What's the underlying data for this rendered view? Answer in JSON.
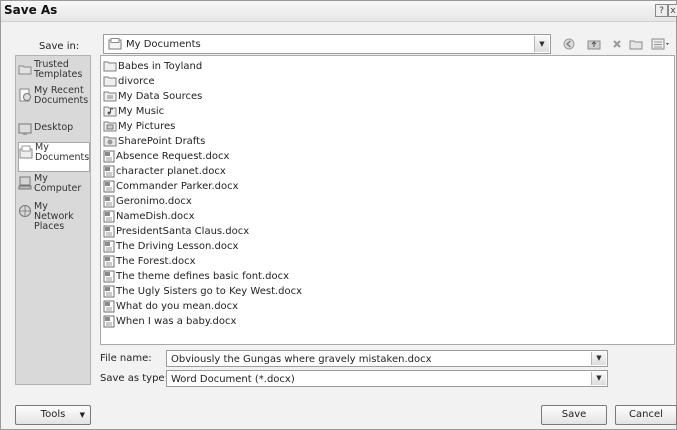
{
  "window": {
    "title": "Save As",
    "help_glyph": "?",
    "close_glyph": "x"
  },
  "save_in": {
    "label": "Save in:",
    "value": "My Documents",
    "toolbar": [
      "back-icon",
      "up-folder-icon",
      "delete-icon",
      "new-folder-icon",
      "views-icon"
    ]
  },
  "places": [
    {
      "label": "Trusted Templates",
      "icon": "trusted-templates-icon",
      "selected": false
    },
    {
      "label": "My Recent Documents",
      "icon": "recent-documents-icon",
      "selected": false
    },
    {
      "label": "Desktop",
      "icon": "desktop-icon",
      "selected": false
    },
    {
      "label": "My Documents",
      "icon": "my-documents-icon",
      "selected": true
    },
    {
      "label": "My Computer",
      "icon": "my-computer-icon",
      "selected": false
    },
    {
      "label": "My Network Places",
      "icon": "network-places-icon",
      "selected": false
    }
  ],
  "files": [
    {
      "name": "Babes in Toyland",
      "type": "folder"
    },
    {
      "name": "divorce",
      "type": "folder"
    },
    {
      "name": "My Data Sources",
      "type": "datasource"
    },
    {
      "name": "My Music",
      "type": "music"
    },
    {
      "name": "My Pictures",
      "type": "pictures"
    },
    {
      "name": "SharePoint Drafts",
      "type": "sharepoint"
    },
    {
      "name": "Absence Request.docx",
      "type": "docx"
    },
    {
      "name": "character planet.docx",
      "type": "docx"
    },
    {
      "name": "Commander Parker.docx",
      "type": "docx"
    },
    {
      "name": "Geronimo.docx",
      "type": "docx"
    },
    {
      "name": "NameDish.docx",
      "type": "docx"
    },
    {
      "name": "PresidentSanta Claus.docx",
      "type": "docx"
    },
    {
      "name": "The Driving Lesson.docx",
      "type": "docx"
    },
    {
      "name": "The Forest.docx",
      "type": "docx"
    },
    {
      "name": "The theme defines basic font.docx",
      "type": "docx"
    },
    {
      "name": "The Ugly Sisters go to Key West.docx",
      "type": "docx"
    },
    {
      "name": "What do you mean.docx",
      "type": "docx"
    },
    {
      "name": "When I was a baby.docx",
      "type": "docx"
    }
  ],
  "file_name": {
    "label": "File name:",
    "value": "Obviously the Gungas where gravely mistaken.docx"
  },
  "save_as_type": {
    "label": "Save as type:",
    "value": "Word Document (*.docx)"
  },
  "buttons": {
    "tools": "Tools",
    "save": "Save",
    "cancel": "Cancel"
  }
}
